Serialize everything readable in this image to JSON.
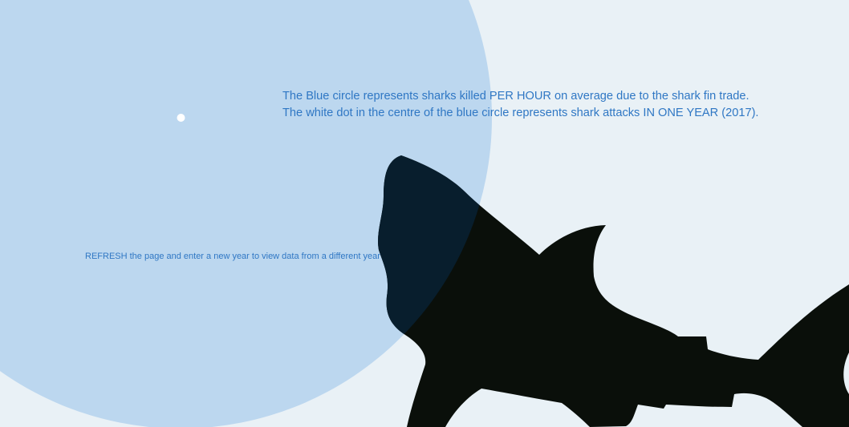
{
  "colors": {
    "background": "#e9f1f6",
    "blue_circle": "#bcd7ef",
    "text": "#2f77c4",
    "white_dot": "#ffffff",
    "shark": "#0a0f0a",
    "shark_overlap": "#081e2d"
  },
  "legend": {
    "line_1": "The Blue circle represents sharks killed PER HOUR on average due to the shark fin trade.",
    "line_2": "The white dot in the centre of the blue circle represents shark attacks IN ONE YEAR (2017)."
  },
  "instructions": {
    "refresh_text": "REFRESH the page and enter a new year to view data from a different year"
  }
}
